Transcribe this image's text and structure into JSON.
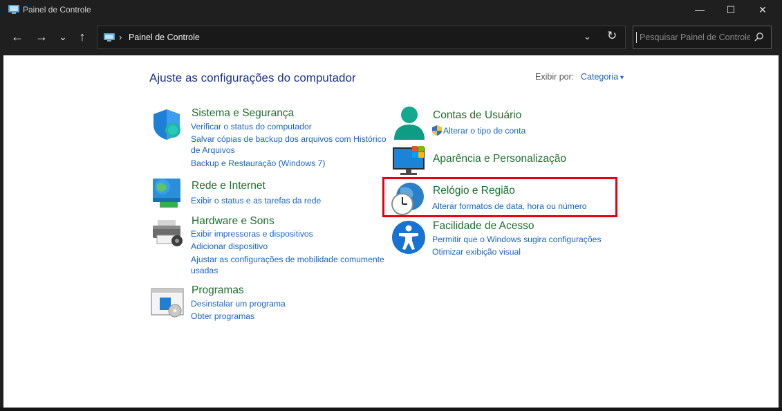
{
  "window": {
    "title": "Painel de Controle",
    "minimize": "—",
    "maximize": "☐",
    "close": "✕"
  },
  "nav": {
    "back": "←",
    "forward": "→",
    "recent": "⌄",
    "up": "↑",
    "separator": "›",
    "path": "Painel de Controle",
    "dropdown": "⌄",
    "refresh": "↻"
  },
  "search": {
    "placeholder": "Pesquisar Painel de Controle"
  },
  "main": {
    "heading": "Ajuste as configurações do computador",
    "view_by_label": "Exibir por:",
    "view_by_value": "Categoria"
  },
  "categories_left": [
    {
      "title": "Sistema e Segurança",
      "icon": "shield-icon",
      "links": [
        "Verificar o status do computador",
        "Salvar cópias de backup dos arquivos com Histórico",
        "de Arquivos",
        "Backup e Restauração (Windows 7)"
      ]
    },
    {
      "title": "Rede e Internet",
      "icon": "network-globe-icon",
      "links": [
        "Exibir o status e as tarefas da rede"
      ]
    },
    {
      "title": "Hardware e Sons",
      "icon": "printer-icon",
      "links": [
        "Exibir impressoras e dispositivos",
        "Adicionar dispositivo",
        "Ajustar as configurações de mobilidade comumente",
        "usadas"
      ]
    },
    {
      "title": "Programas",
      "icon": "programs-icon",
      "links": [
        "Desinstalar um programa",
        "Obter programas"
      ]
    }
  ],
  "categories_right": [
    {
      "title": "Contas de Usuário",
      "icon": "user-accounts-icon",
      "links": [
        "Alterar o tipo de conta"
      ]
    },
    {
      "title": "Aparência e Personalização",
      "icon": "appearance-icon",
      "links": []
    },
    {
      "title": "Relógio e Região",
      "icon": "clock-globe-icon",
      "links": [
        "Alterar formatos de data, hora ou número"
      ]
    },
    {
      "title": "Facilidade de Acesso",
      "icon": "accessibility-icon",
      "links": [
        "Permitir que o Windows sugira configurações",
        "Otimizar exibição visual"
      ]
    }
  ],
  "colors": {
    "title_green": "#1c6e2e",
    "link_blue": "#1a62c4",
    "heading_blue": "#1e3287",
    "highlight_red": "#e3000f",
    "chrome_dark": "#1f1f1f"
  }
}
